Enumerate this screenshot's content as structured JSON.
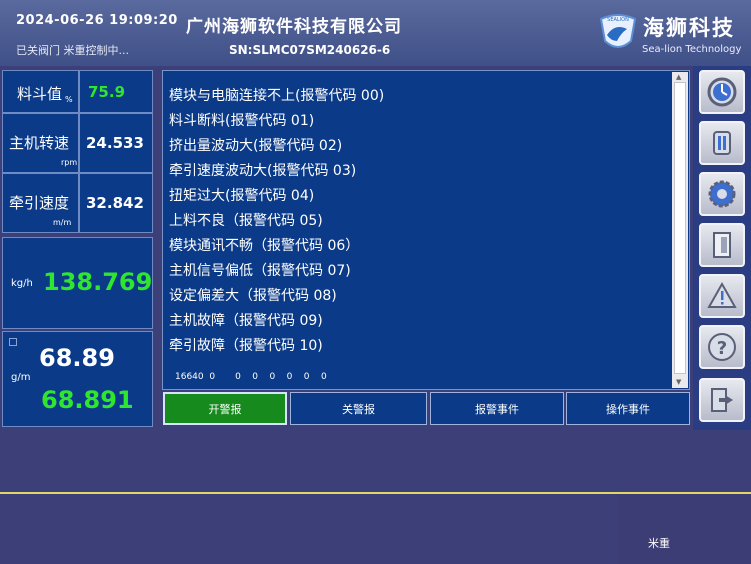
{
  "header": {
    "datetime": "2024-06-26  19:09:20",
    "status": "已关阀门 米重控制中...",
    "company": "广州海狮软件科技有限公司",
    "sn": "SN:SLMC07SM240626-6",
    "logo_cn": "海狮科技",
    "logo_en": "Sea-lion Technology",
    "logo_emblem_text": "SEALION"
  },
  "left": {
    "hopper": {
      "label": "料斗值",
      "unit": "%",
      "value": "75.9"
    },
    "screw": {
      "label": "主机转速",
      "unit": "rpm",
      "value": "24.533"
    },
    "haul": {
      "label": "牵引速度",
      "unit": "m/m",
      "value": "32.842"
    },
    "output": {
      "unit": "kg/h",
      "value": "138.769"
    },
    "weight": {
      "unit": "g/m",
      "set_value": "68.89",
      "actual_value": "68.891"
    }
  },
  "alarms": [
    "模块与电脑连接不上(报警代码 00)",
    "料斗断料(报警代码 01)",
    "挤出量波动大(报警代码 02)",
    "牵引速度波动大(报警代码 03)",
    "扭矩过大(报警代码 04)",
    "上料不良（报警代码 05)",
    "模块通讯不畅（报警代码 06）",
    "主机信号偏低（报警代码 07)",
    "设定偏差大（报警代码 08)",
    "主机故障（报警代码 09)",
    "牵引故障（报警代码 10)"
  ],
  "alarm_footer": "16640  0       0    0    0    0    0    0",
  "tabs": [
    "开警报",
    "关警报",
    "报警事件",
    "操作事件"
  ],
  "nav_icons": [
    "clock-icon",
    "settings-tool-icon",
    "gear-icon",
    "door-icon",
    "warning-icon",
    "help-icon",
    "exit-icon"
  ],
  "bottom_label": "米重",
  "colors": {
    "panel": "#0b3b88",
    "green_value": "#2ee62e",
    "active_tab": "#168a1c",
    "background": "#3d3f78"
  }
}
